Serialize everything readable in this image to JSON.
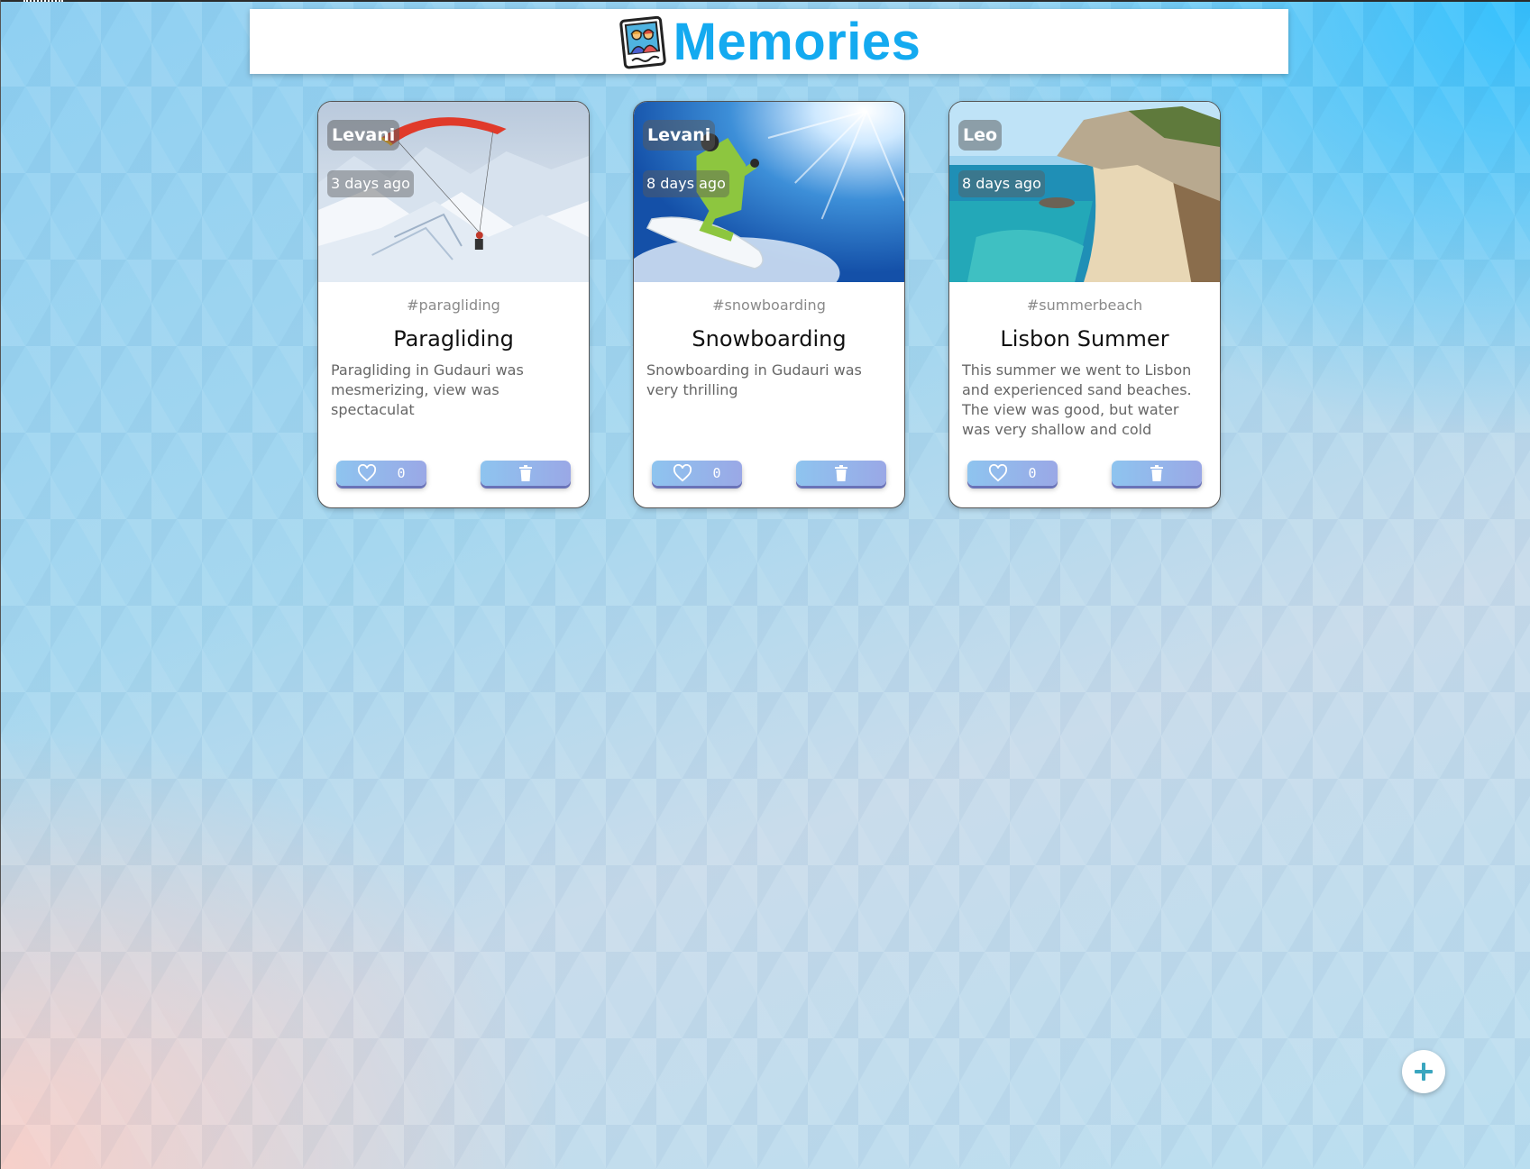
{
  "header": {
    "title": "Memories",
    "logo_icon": "photo-memories-icon",
    "title_color": "#14aaf0"
  },
  "posts": [
    {
      "creator": "Levani",
      "created_at": "3 days ago",
      "tags": "#paragliding",
      "title": "Paragliding",
      "message": "Paragliding in Gudauri was mesmerizing, view was spectaculat",
      "like_count": "0",
      "image": "paraglider-over-snowy-mountains"
    },
    {
      "creator": "Levani",
      "created_at": "8 days ago",
      "tags": "#snowboarding",
      "title": "Snowboarding",
      "message": "Snowboarding in Gudauri was very thrilling",
      "like_count": "0",
      "image": "snowboarder-jumping-blue-sky"
    },
    {
      "creator": "Leo",
      "created_at": "8 days ago",
      "tags": "#summerbeach",
      "title": "Lisbon Summer",
      "message": "This summer we went to Lisbon and experienced sand beaches. The view was good, but water was very shallow and cold",
      "like_count": "0",
      "image": "coastal-beach-cliffs"
    }
  ],
  "icons": {
    "like": "heart-outline-icon",
    "delete": "trash-icon",
    "add": "plus-icon"
  },
  "theme": {
    "button_gradient": [
      "#8ec4ef",
      "#9aa8e6"
    ],
    "fab_icon_color": "#3aa6bf"
  }
}
